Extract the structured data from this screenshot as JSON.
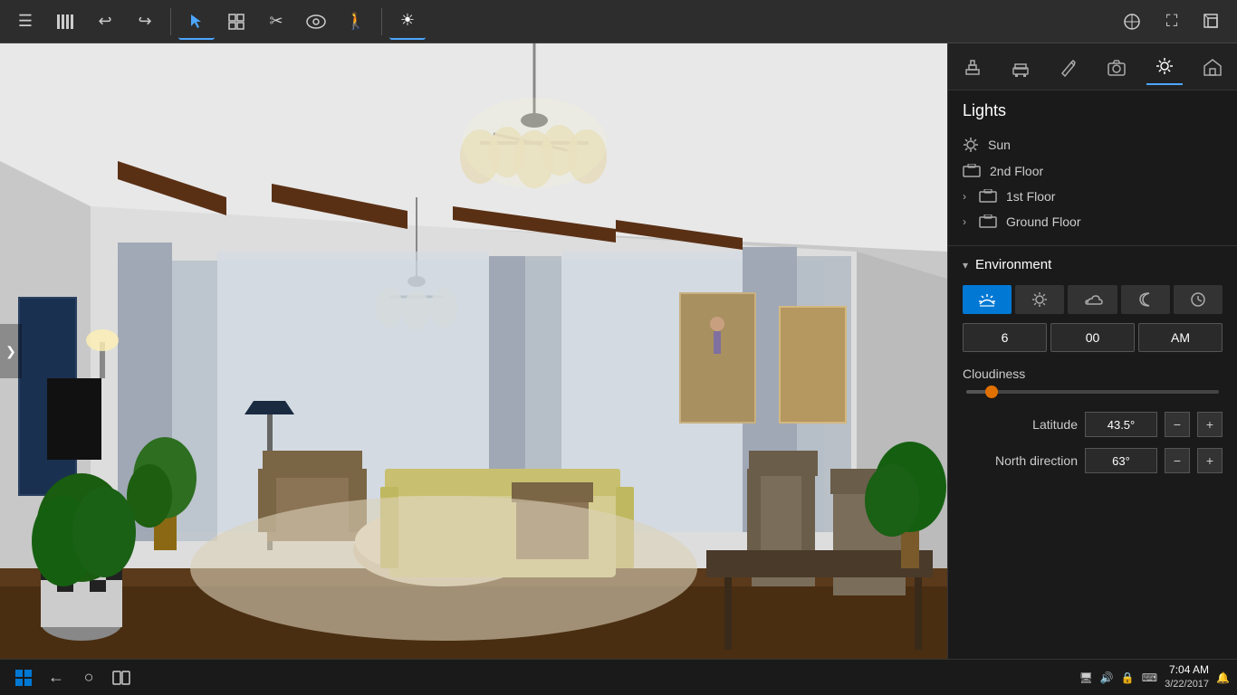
{
  "toolbar": {
    "buttons": [
      {
        "id": "menu",
        "icon": "☰",
        "active": false
      },
      {
        "id": "library",
        "icon": "📚",
        "active": false
      },
      {
        "id": "undo",
        "icon": "↩",
        "active": false
      },
      {
        "id": "redo",
        "icon": "↪",
        "active": false
      },
      {
        "id": "select",
        "icon": "↖",
        "active": true
      },
      {
        "id": "arrange",
        "icon": "⊞",
        "active": false
      },
      {
        "id": "measure",
        "icon": "✂",
        "active": false
      },
      {
        "id": "view",
        "icon": "👁",
        "active": false
      },
      {
        "id": "walk",
        "icon": "🚶",
        "active": false
      },
      {
        "id": "lighting",
        "icon": "☀",
        "active": true
      },
      {
        "id": "dimensions",
        "icon": "📐",
        "active": false
      },
      {
        "id": "fullscreen",
        "icon": "⛶",
        "active": false
      },
      {
        "id": "threed",
        "icon": "◻",
        "active": false
      }
    ]
  },
  "panel": {
    "tabs": [
      {
        "id": "build",
        "icon": "🔨",
        "active": false
      },
      {
        "id": "furnish",
        "icon": "🏠",
        "active": false
      },
      {
        "id": "decorate",
        "icon": "✏",
        "active": false
      },
      {
        "id": "camera",
        "icon": "📷",
        "active": false
      },
      {
        "id": "light",
        "icon": "☀",
        "active": true
      },
      {
        "id": "exterior",
        "icon": "🏡",
        "active": false
      }
    ],
    "lights_title": "Lights",
    "light_items": [
      {
        "label": "Sun",
        "icon": "sun",
        "hasChevron": false
      },
      {
        "label": "2nd Floor",
        "icon": "floor",
        "hasChevron": false
      },
      {
        "label": "1st Floor",
        "icon": "floor",
        "hasChevron": true
      },
      {
        "label": "Ground Floor",
        "icon": "floor",
        "hasChevron": true
      }
    ],
    "environment": {
      "title": "Environment",
      "time_buttons": [
        {
          "id": "sunrise",
          "icon": "🌅",
          "active": true
        },
        {
          "id": "sunny",
          "icon": "☀",
          "active": false
        },
        {
          "id": "cloudy",
          "icon": "☁",
          "active": false
        },
        {
          "id": "night",
          "icon": "☽",
          "active": false
        },
        {
          "id": "clock",
          "icon": "🕐",
          "active": false
        }
      ],
      "time_hour": "6",
      "time_minute": "00",
      "time_ampm": "AM",
      "cloudiness_label": "Cloudiness",
      "slider_value": 10,
      "latitude_label": "Latitude",
      "latitude_value": "43.5°",
      "north_label": "North direction",
      "north_value": "63°"
    }
  },
  "viewport": {
    "nav_arrow": "❯"
  },
  "taskbar": {
    "time": "7:04 AM",
    "date": "3/22/2017",
    "sys_icons": [
      "🔊",
      "🔒",
      "⌨"
    ]
  }
}
